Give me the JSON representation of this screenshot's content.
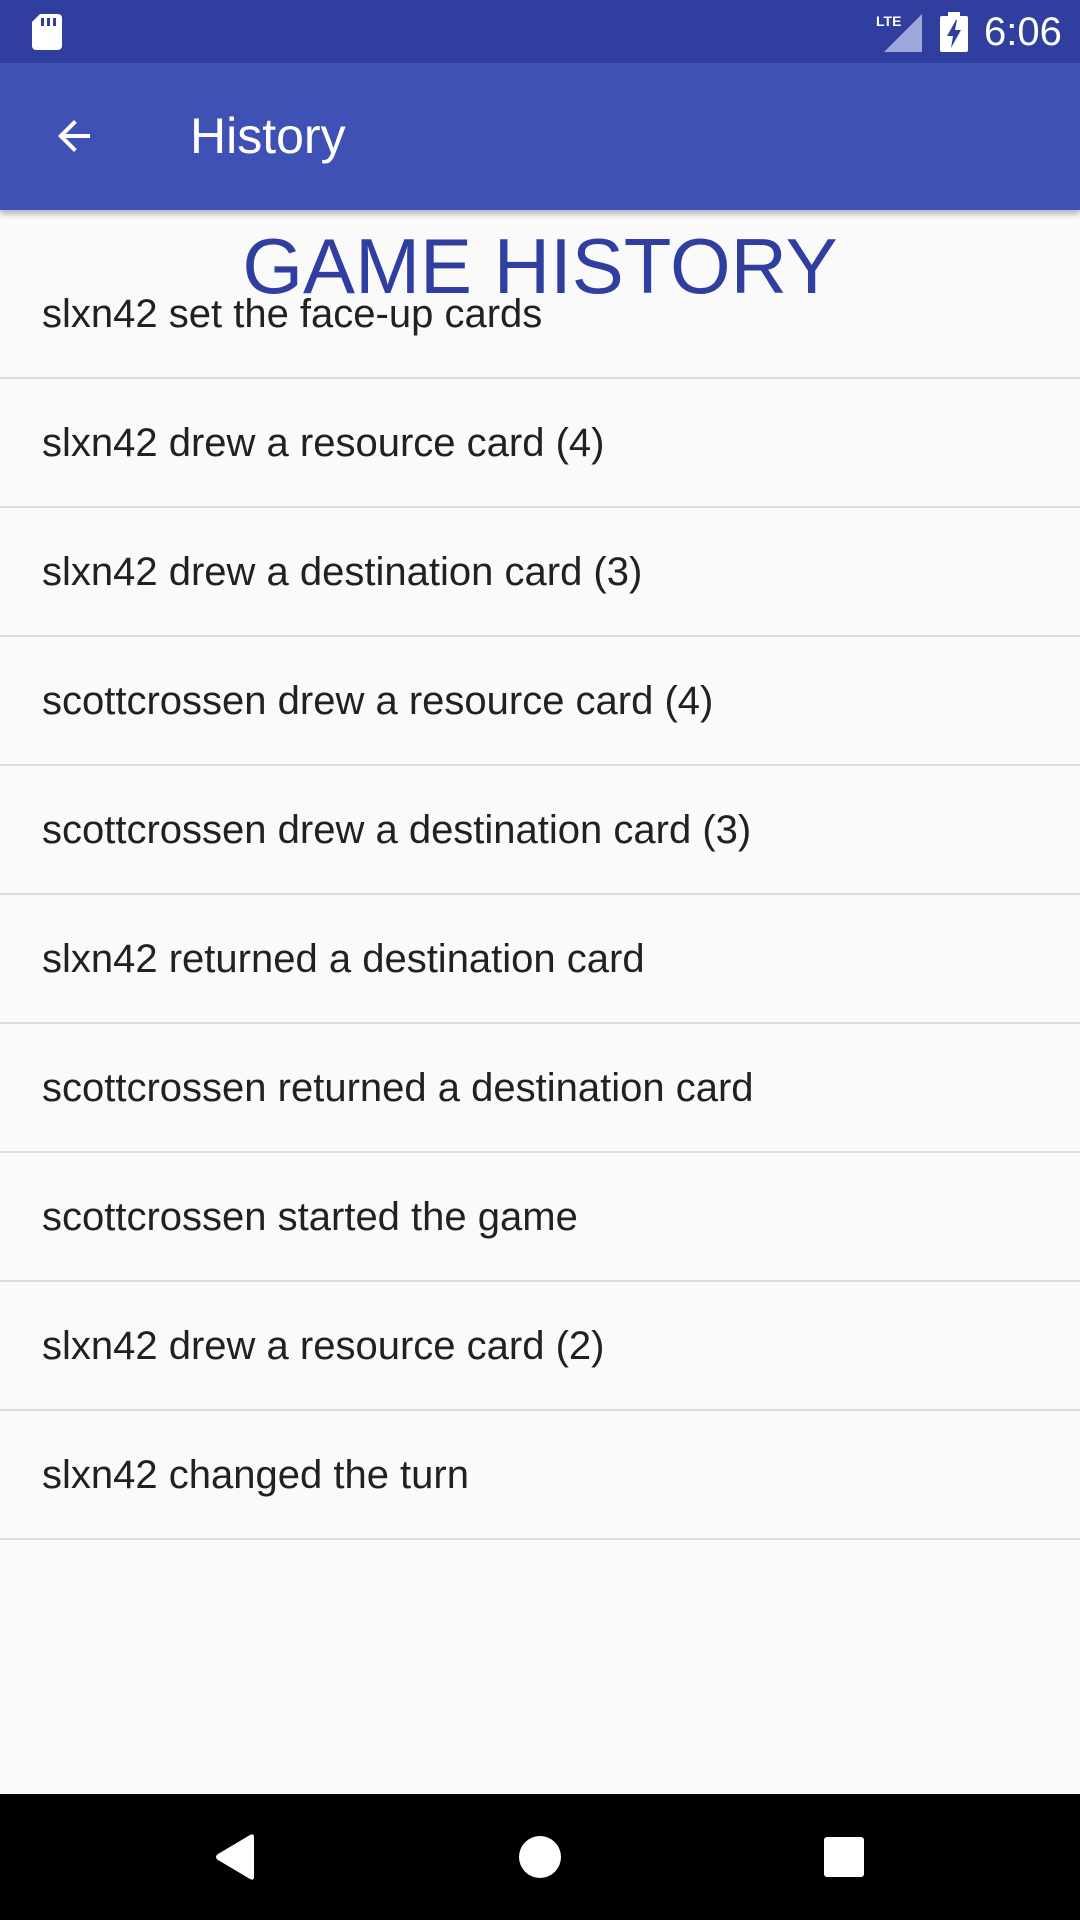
{
  "status_bar": {
    "time": "6:06",
    "network": "LTE",
    "icons": [
      "sd-card-icon",
      "lte-signal-icon",
      "battery-charging-icon"
    ]
  },
  "app_bar": {
    "title": "History",
    "back_icon": "arrow-back-icon"
  },
  "heading": "GAME HISTORY",
  "history": {
    "items": [
      "slxn42 set the face-up cards",
      "slxn42 drew a resource card (4)",
      "slxn42 drew a destination card (3)",
      "scottcrossen drew a resource card (4)",
      "scottcrossen drew a destination card (3)",
      "slxn42 returned a destination card",
      "scottcrossen returned a destination card",
      "scottcrossen started the game",
      "slxn42 drew a resource card (2)",
      "slxn42 changed the turn"
    ]
  },
  "nav_bar": {
    "buttons": [
      "back-triangle-icon",
      "home-circle-icon",
      "recents-square-icon"
    ]
  },
  "colors": {
    "status_bar": "#303f9f",
    "app_bar": "#3f51b5",
    "heading": "#303f9f",
    "background": "#fafafa",
    "divider": "#dcdcdc"
  }
}
